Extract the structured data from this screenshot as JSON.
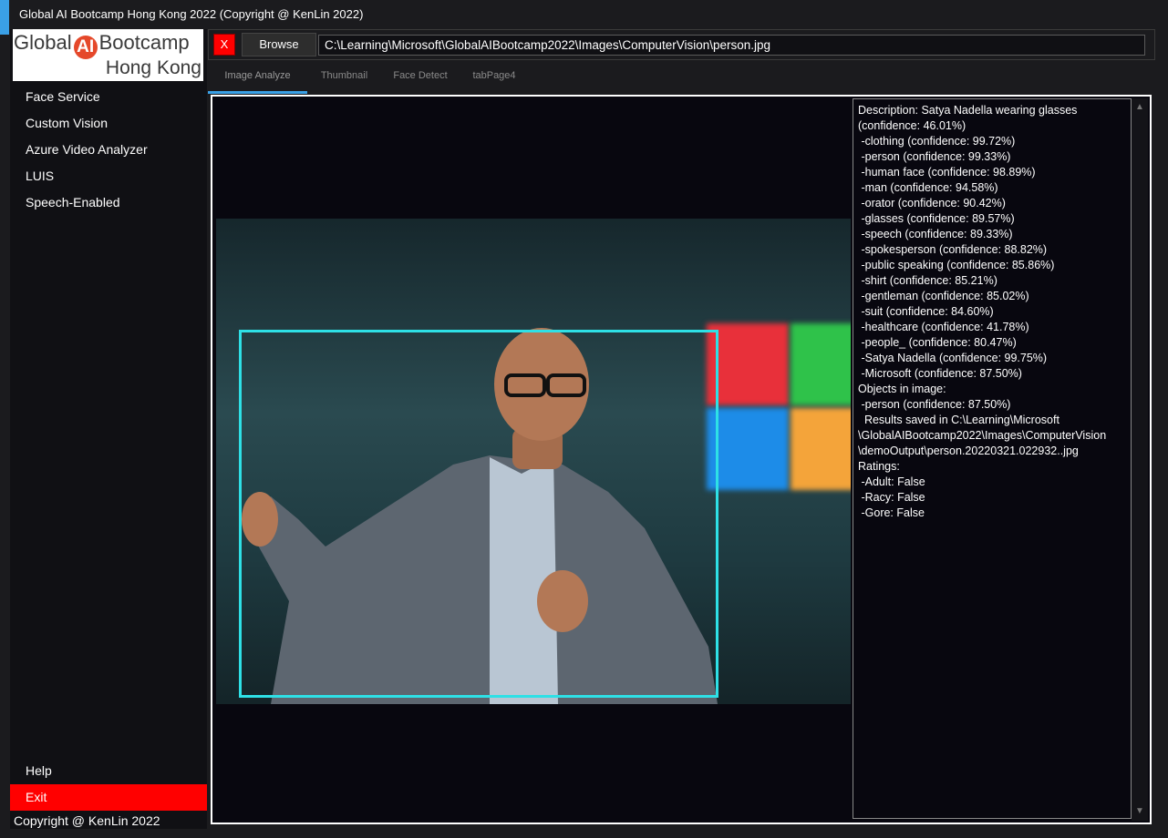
{
  "window": {
    "title": "Global AI Bootcamp Hong Kong 2022 (Copyright @ KenLin 2022)"
  },
  "logo": {
    "line1_pre": "Global",
    "line1_ai": "AI",
    "line1_post": "Bootcamp",
    "line2": "Hong Kong"
  },
  "sidebar": {
    "items": [
      {
        "label": "Face Service"
      },
      {
        "label": "Custom Vision"
      },
      {
        "label": "Azure Video Analyzer"
      },
      {
        "label": "LUIS"
      },
      {
        "label": "Speech-Enabled"
      }
    ],
    "help": "Help",
    "exit": "Exit",
    "copyright": "Copyright @ KenLin 2022"
  },
  "toolbar": {
    "close_label": "X",
    "browse_label": "Browse",
    "path_value": "C:\\Learning\\Microsoft\\GlobalAIBootcamp2022\\Images\\ComputerVision\\person.jpg"
  },
  "tabs": [
    {
      "label": "Image Analyze",
      "active": true
    },
    {
      "label": "Thumbnail"
    },
    {
      "label": "Face Detect"
    },
    {
      "label": "tabPage4"
    }
  ],
  "results": {
    "text": "Description: Satya Nadella wearing glasses\n(confidence: 46.01%)\n -clothing (confidence: 99.72%)\n -person (confidence: 99.33%)\n -human face (confidence: 98.89%)\n -man (confidence: 94.58%)\n -orator (confidence: 90.42%)\n -glasses (confidence: 89.57%)\n -speech (confidence: 89.33%)\n -spokesperson (confidence: 88.82%)\n -public speaking (confidence: 85.86%)\n -shirt (confidence: 85.21%)\n -gentleman (confidence: 85.02%)\n -suit (confidence: 84.60%)\n -healthcare (confidence: 41.78%)\n -people_ (confidence: 80.47%)\n -Satya Nadella (confidence: 99.75%)\n -Microsoft (confidence: 87.50%)\nObjects in image:\n -person (confidence: 87.50%)\n  Results saved in C:\\Learning\\Microsoft\n\\GlobalAIBootcamp2022\\Images\\ComputerVision\n\\demoOutput\\person.20220321.022932..jpg\nRatings:\n -Adult: False\n -Racy: False\n -Gore: False"
  },
  "colors": {
    "accent": "#3aa0e6",
    "exit": "#ff0000",
    "box": "#2ee0e6"
  }
}
